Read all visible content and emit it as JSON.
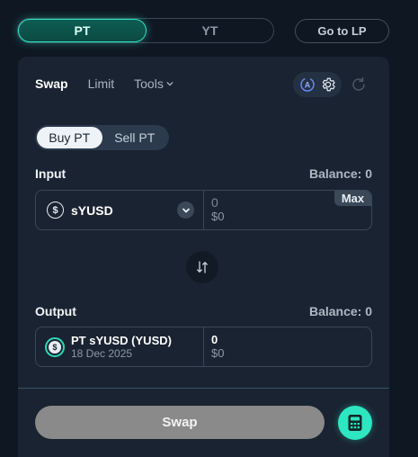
{
  "toggle": {
    "pt_label": "PT",
    "yt_label": "YT",
    "go_lp_label": "Go to LP"
  },
  "tabs": {
    "swap": "Swap",
    "limit": "Limit",
    "tools": "Tools"
  },
  "mode": {
    "buy": "Buy PT",
    "sell": "Sell PT"
  },
  "input": {
    "label": "Input",
    "balance": "Balance: 0",
    "token": "sYUSD",
    "amount": "0",
    "usd": "$0",
    "max_label": "Max"
  },
  "output": {
    "label": "Output",
    "balance": "Balance: 0",
    "token": "PT sYUSD (YUSD)",
    "date": "18 Dec 2025",
    "amount": "0",
    "usd": "$0"
  },
  "swap_button": "Swap",
  "icons": {
    "coin_glyph": "$",
    "accent": "#2ee6c2",
    "button_disabled": "#8a8a8a"
  }
}
